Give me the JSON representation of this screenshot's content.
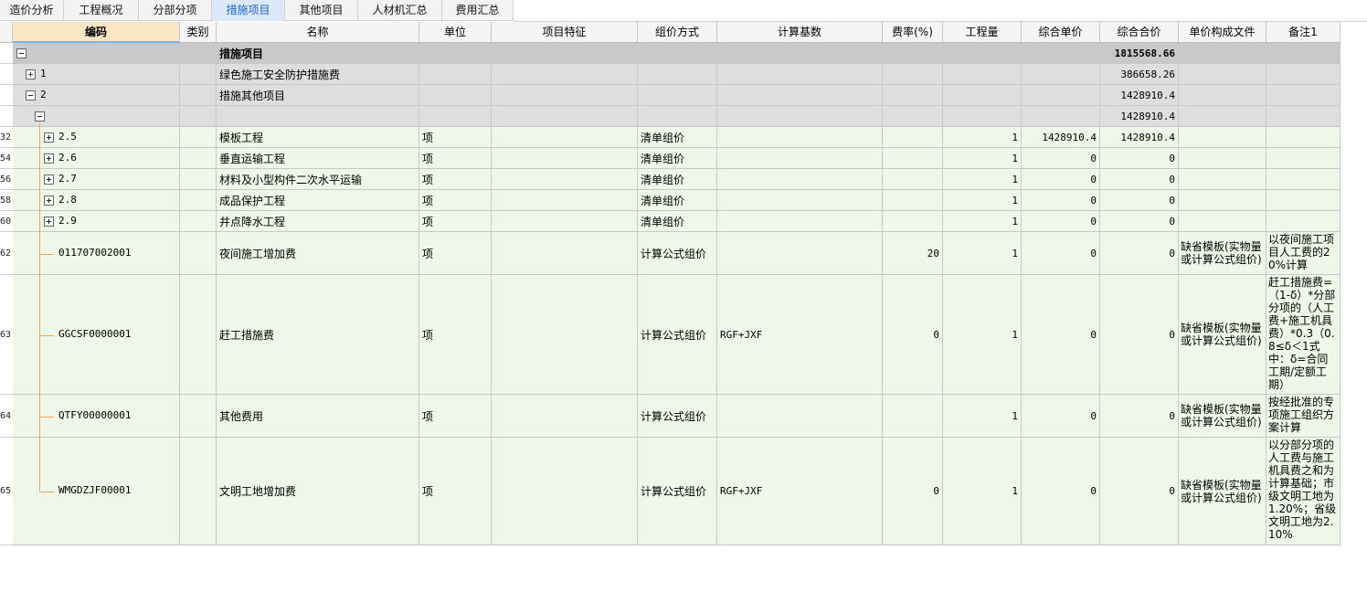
{
  "tabs": [
    {
      "label": "造价分析",
      "active": false
    },
    {
      "label": "工程概况",
      "active": false
    },
    {
      "label": "分部分项",
      "active": false
    },
    {
      "label": "措施项目",
      "active": true
    },
    {
      "label": "其他项目",
      "active": false
    },
    {
      "label": "人材机汇总",
      "active": false
    },
    {
      "label": "费用汇总",
      "active": false
    }
  ],
  "columns": [
    "编码",
    "类别",
    "名称",
    "单位",
    "项目特征",
    "组价方式",
    "计算基数",
    "费率(%)",
    "工程量",
    "综合单价",
    "综合合价",
    "单价构成文件",
    "备注1"
  ],
  "rows": [
    {
      "rownum": "",
      "code": "",
      "category": "",
      "name": "措施项目",
      "unit": "",
      "feature": "",
      "method": "",
      "base": "",
      "rate": "",
      "qty": "",
      "unit_price": "",
      "total": "1815568.66",
      "price_file": "",
      "remark": ""
    },
    {
      "rownum": "",
      "code": "1",
      "category": "",
      "name": "绿色施工安全防护措施费",
      "unit": "",
      "feature": "",
      "method": "",
      "base": "",
      "rate": "",
      "qty": "",
      "unit_price": "",
      "total": "386658.26",
      "price_file": "",
      "remark": ""
    },
    {
      "rownum": "",
      "code": "2",
      "category": "",
      "name": "措施其他项目",
      "unit": "",
      "feature": "",
      "method": "",
      "base": "",
      "rate": "",
      "qty": "",
      "unit_price": "",
      "total": "1428910.4",
      "price_file": "",
      "remark": ""
    },
    {
      "rownum": "",
      "code": "",
      "category": "",
      "name": "",
      "unit": "",
      "feature": "",
      "method": "",
      "base": "",
      "rate": "",
      "qty": "",
      "unit_price": "",
      "total": "1428910.4",
      "price_file": "",
      "remark": ""
    },
    {
      "rownum": "32",
      "code": "2.5",
      "category": "",
      "name": "模板工程",
      "unit": "项",
      "feature": "",
      "method": "清单组价",
      "base": "",
      "rate": "",
      "qty": "1",
      "unit_price": "1428910.4",
      "total": "1428910.4",
      "price_file": "",
      "remark": ""
    },
    {
      "rownum": "54",
      "code": "2.6",
      "category": "",
      "name": "垂直运输工程",
      "unit": "项",
      "feature": "",
      "method": "清单组价",
      "base": "",
      "rate": "",
      "qty": "1",
      "unit_price": "0",
      "total": "0",
      "price_file": "",
      "remark": ""
    },
    {
      "rownum": "56",
      "code": "2.7",
      "category": "",
      "name": "材料及小型构件二次水平运输",
      "unit": "项",
      "feature": "",
      "method": "清单组价",
      "base": "",
      "rate": "",
      "qty": "1",
      "unit_price": "0",
      "total": "0",
      "price_file": "",
      "remark": ""
    },
    {
      "rownum": "58",
      "code": "2.8",
      "category": "",
      "name": "成品保护工程",
      "unit": "项",
      "feature": "",
      "method": "清单组价",
      "base": "",
      "rate": "",
      "qty": "1",
      "unit_price": "0",
      "total": "0",
      "price_file": "",
      "remark": ""
    },
    {
      "rownum": "60",
      "code": "2.9",
      "category": "",
      "name": "井点降水工程",
      "unit": "项",
      "feature": "",
      "method": "清单组价",
      "base": "",
      "rate": "",
      "qty": "1",
      "unit_price": "0",
      "total": "0",
      "price_file": "",
      "remark": ""
    },
    {
      "rownum": "62",
      "code": "011707002001",
      "category": "",
      "name": "夜间施工增加费",
      "unit": "项",
      "feature": "",
      "method": "计算公式组价",
      "base": "",
      "rate": "20",
      "qty": "1",
      "unit_price": "0",
      "total": "0",
      "price_file": "缺省模板(实物量或计算公式组价)",
      "remark": "以夜间施工项目人工费的20%计算"
    },
    {
      "rownum": "63",
      "code": "GGCSF0000001",
      "category": "",
      "name": "赶工措施费",
      "unit": "项",
      "feature": "",
      "method": "计算公式组价",
      "base": "RGF+JXF",
      "rate": "0",
      "qty": "1",
      "unit_price": "0",
      "total": "0",
      "price_file": "缺省模板(实物量或计算公式组价)",
      "remark": "赶工措施费=（1-δ）*分部分项的（人工费+施工机具费）*0.3（0.8≤δ＜1式中：δ=合同工期/定额工期）"
    },
    {
      "rownum": "64",
      "code": "QTFY00000001",
      "category": "",
      "name": "其他费用",
      "unit": "项",
      "feature": "",
      "method": "计算公式组价",
      "base": "",
      "rate": "",
      "qty": "1",
      "unit_price": "0",
      "total": "0",
      "price_file": "缺省模板(实物量或计算公式组价)",
      "remark": "按经批准的专项施工组织方案计算"
    },
    {
      "rownum": "65",
      "code": "WMGDZJF00001",
      "category": "",
      "name": "文明工地增加费",
      "unit": "项",
      "feature": "",
      "method": "计算公式组价",
      "base": "RGF+JXF",
      "rate": "0",
      "qty": "1",
      "unit_price": "0",
      "total": "0",
      "price_file": "缺省模板(实物量或计算公式组价)",
      "remark": "以分部分项的人工费与施工机具费之和为计算基础；市级文明工地为1.20%；省级文明工地为2.10%"
    }
  ],
  "colors": {
    "header_bg": "#f5f5f5",
    "selected_header_bg": "#fbe6c6",
    "root_row_bg": "#c9c9c9",
    "group_row_bg": "#dedede",
    "item_row_bg": "#eef7e8",
    "tree_line": "#e8a65a",
    "active_tab_text": "#1a66c8"
  }
}
